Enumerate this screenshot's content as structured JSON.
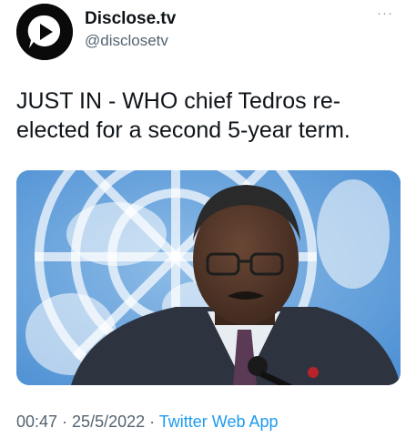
{
  "account": {
    "name": "Disclose.tv",
    "handle": "@disclosetv",
    "avatar_icon": "play-speech-bubble-icon"
  },
  "menu": {
    "icon": "more-dots-icon",
    "label": "···"
  },
  "tweet": {
    "text_line1": "JUST IN - WHO chief Tedros re-",
    "text_line2": "elected for a second 5-year term."
  },
  "meta": {
    "time": "00:47",
    "sep1": " · ",
    "date": "25/5/2022",
    "sep2": " · ",
    "source": "Twitter Web App"
  },
  "colors": {
    "link": "#1d9bf0",
    "muted": "#536471",
    "un_blue": "#5b9ad7"
  }
}
